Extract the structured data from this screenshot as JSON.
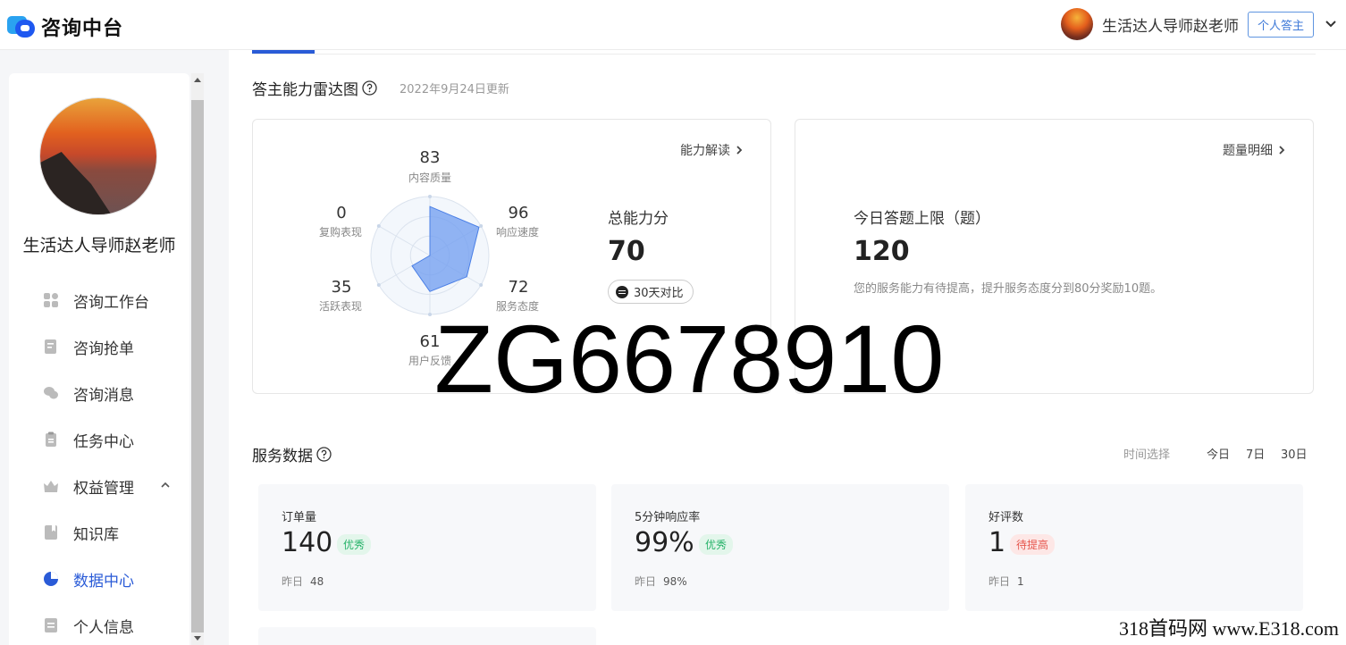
{
  "app": {
    "logo_text": "咨询中台"
  },
  "header": {
    "user_name": "生活达人导师赵老师",
    "role_badge": "个人答主"
  },
  "sidebar": {
    "user_name": "生活达人导师赵老师",
    "items": [
      {
        "label": "咨询工作台",
        "icon": "dashboard-icon",
        "active": false
      },
      {
        "label": "咨询抢单",
        "icon": "edit-note-icon",
        "active": false
      },
      {
        "label": "咨询消息",
        "icon": "chat-icon",
        "active": false
      },
      {
        "label": "任务中心",
        "icon": "clipboard-icon",
        "active": false
      },
      {
        "label": "权益管理",
        "icon": "crown-icon",
        "active": false,
        "expanded": true
      },
      {
        "label": "知识库",
        "icon": "book-icon",
        "active": false
      },
      {
        "label": "数据中心",
        "icon": "pie-chart-icon",
        "active": true
      },
      {
        "label": "个人信息",
        "icon": "profile-icon",
        "active": false
      }
    ]
  },
  "radar_section": {
    "title": "答主能力雷达图",
    "updated": "2022年9月24日更新",
    "link": "能力解读",
    "axes": [
      {
        "name": "内容质量",
        "value": 83
      },
      {
        "name": "响应速度",
        "value": 96
      },
      {
        "name": "服务态度",
        "value": 72
      },
      {
        "name": "用户反馈",
        "value": 61
      },
      {
        "name": "活跃表现",
        "value": 35
      },
      {
        "name": "复购表现",
        "value": 0
      }
    ],
    "total_label": "总能力分",
    "total_value": "70",
    "compare_label": "30天对比"
  },
  "limit_section": {
    "link": "题量明细",
    "label": "今日答题上限（题）",
    "value": "120",
    "note": "您的服务能力有待提高，提升服务态度分到80分奖励10题。"
  },
  "service_section": {
    "title": "服务数据",
    "time_label": "时间选择",
    "time_options": [
      "今日",
      "7日",
      "30日"
    ],
    "stats": [
      {
        "title": "订单量",
        "value": "140",
        "badge": "优秀",
        "badge_type": "good",
        "yesterday_label": "昨日",
        "yesterday_value": "48"
      },
      {
        "title": "5分钟响应率",
        "value": "99%",
        "badge": "优秀",
        "badge_type": "good",
        "yesterday_label": "昨日",
        "yesterday_value": "98%"
      },
      {
        "title": "好评数",
        "value": "1",
        "badge": "待提高",
        "badge_type": "warn",
        "yesterday_label": "昨日",
        "yesterday_value": "1"
      }
    ]
  },
  "overlay": {
    "watermark": "ZG6678910",
    "footer": "318首码网  www.E318.com"
  },
  "colors": {
    "accent": "#2a5bd7",
    "radar_fill": "#6f9cf0",
    "good": "#27b36a",
    "warn": "#e6564d"
  }
}
